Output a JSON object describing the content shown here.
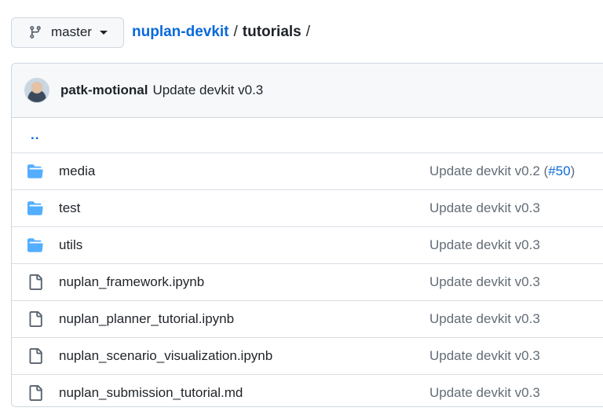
{
  "branch": {
    "label": "master"
  },
  "breadcrumb": {
    "repo": "nuplan-devkit",
    "separator": "/",
    "directory": "tutorials",
    "trailing_separator": "/"
  },
  "commit": {
    "author": "patk-motional",
    "message": "Update devkit v0.3"
  },
  "parent": {
    "label": ".."
  },
  "files": [
    {
      "type": "folder",
      "icon": "folder-icon",
      "name": "media",
      "message": "Update devkit v0.2 (",
      "pr": "#50",
      "message_end": ")"
    },
    {
      "type": "folder",
      "icon": "folder-icon",
      "name": "test",
      "message": "Update devkit v0.3",
      "pr": "",
      "message_end": ""
    },
    {
      "type": "folder",
      "icon": "folder-icon",
      "name": "utils",
      "message": "Update devkit v0.3",
      "pr": "",
      "message_end": ""
    },
    {
      "type": "file",
      "icon": "file-icon",
      "name": "nuplan_framework.ipynb",
      "message": "Update devkit v0.3",
      "pr": "",
      "message_end": ""
    },
    {
      "type": "file",
      "icon": "file-icon",
      "name": "nuplan_planner_tutorial.ipynb",
      "message": "Update devkit v0.3",
      "pr": "",
      "message_end": ""
    },
    {
      "type": "file",
      "icon": "file-icon",
      "name": "nuplan_scenario_visualization.ipynb",
      "message": "Update devkit v0.3",
      "pr": "",
      "message_end": ""
    },
    {
      "type": "file",
      "icon": "file-icon",
      "name": "nuplan_submission_tutorial.md",
      "message": "Update devkit v0.3",
      "pr": "",
      "message_end": ""
    }
  ],
  "colors": {
    "folder": "#54aeff",
    "link": "#0969da",
    "muted": "#636c76",
    "border": "#d0d7de"
  }
}
